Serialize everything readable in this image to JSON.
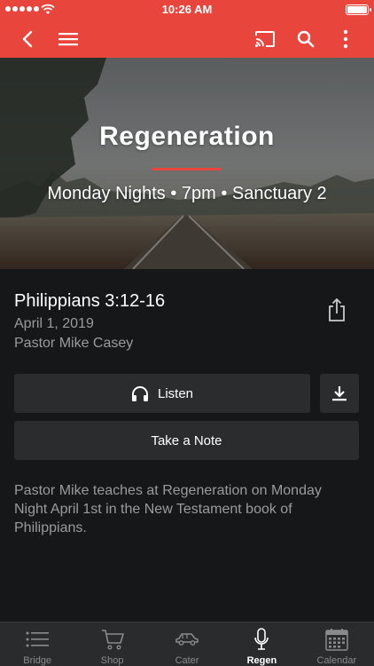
{
  "status_bar": {
    "time": "10:26 AM"
  },
  "top_nav": {
    "icons": [
      "back-icon",
      "menu-icon",
      "cast-icon",
      "search-icon",
      "more-vertical-icon"
    ],
    "accent_color": "#e8453c"
  },
  "hero": {
    "title": "Regeneration",
    "subtitle": "Monday Nights • 7pm • Sanctuary 2"
  },
  "sermon": {
    "title": "Philippians 3:12-16",
    "date": "April 1, 2019",
    "pastor": "Pastor Mike Casey",
    "description": "Pastor Mike teaches at Regeneration on Monday Night April 1st in the New Testament book of Philippians."
  },
  "actions": {
    "listen_label": "Listen",
    "note_label": "Take a Note",
    "icons": [
      "share-icon",
      "headphones-icon",
      "download-icon"
    ]
  },
  "tab_bar": {
    "tabs": [
      {
        "label": "Bridge",
        "icon": "list-icon",
        "active": false
      },
      {
        "label": "Shop",
        "icon": "cart-icon",
        "active": false
      },
      {
        "label": "Cater",
        "icon": "car-icon",
        "active": false
      },
      {
        "label": "Regen",
        "icon": "microphone-icon",
        "active": true
      },
      {
        "label": "Calendar",
        "icon": "calendar-icon",
        "active": false
      }
    ]
  }
}
